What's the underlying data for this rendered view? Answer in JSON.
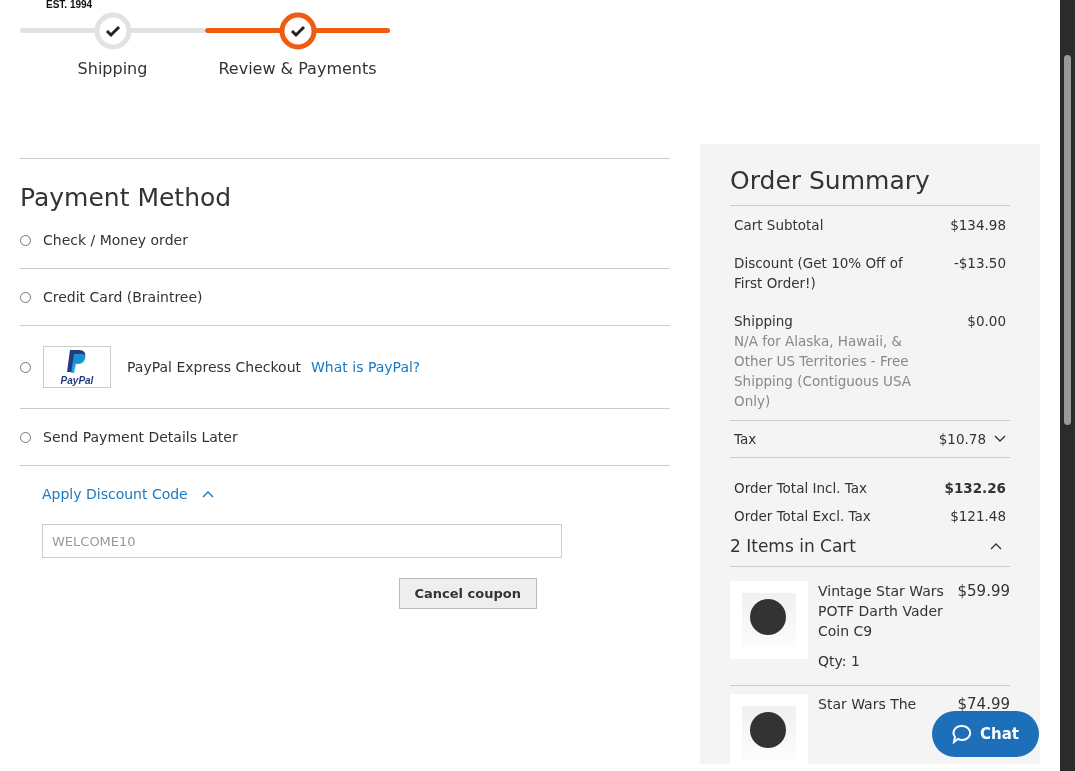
{
  "brand": {
    "tagline": "EST. 1994"
  },
  "steps": [
    {
      "label": "Shipping",
      "selected": false
    },
    {
      "label": "Review & Payments",
      "selected": true
    }
  ],
  "payment": {
    "title": "Payment Method",
    "methods": [
      {
        "kind": "plain",
        "label": "Check / Money order",
        "selected": false
      },
      {
        "kind": "plain",
        "label": "Credit Card (Braintree)",
        "selected": false
      },
      {
        "kind": "paypal",
        "label": "PayPal Express Checkout",
        "logo_text": "PayPal",
        "link": "What is PayPal?",
        "selected": false
      },
      {
        "kind": "plain",
        "label": "Send Payment Details Later",
        "selected": false
      }
    ]
  },
  "discount": {
    "toggle": "Apply Discount Code",
    "expanded": true,
    "value": "WELCOME10",
    "disabled": true,
    "button": "Cancel coupon"
  },
  "summary": {
    "title": "Order Summary",
    "rows": [
      {
        "kind": "line",
        "label": "Cart Subtotal",
        "value": "$134.98"
      },
      {
        "kind": "line",
        "label": "Discount (Get 10% Off of First Order!)",
        "value": "-$13.50"
      },
      {
        "kind": "note",
        "label": "Shipping",
        "note": "N/A for Alaska, Hawaii, & Other US Territories - Free Shipping (Contiguous USA Only)",
        "value": "$0.00"
      },
      {
        "kind": "toggle",
        "label": "Tax",
        "value": "$10.78",
        "expanded": false
      }
    ],
    "totals": [
      {
        "label": "Order Total Incl. Tax",
        "value": "$132.26",
        "bold": true
      },
      {
        "label": "Order Total Excl. Tax",
        "value": "$121.48",
        "bold": false
      }
    ],
    "cart_title": "2 Items in Cart",
    "cart_expanded": true,
    "items": [
      {
        "name": "Vintage Star Wars POTF Darth Vader Coin C9",
        "price": "$59.99",
        "qty": "Qty: 1"
      },
      {
        "name": "Star Wars The",
        "price": "$74.99"
      }
    ]
  },
  "chat": {
    "label": "Chat"
  }
}
